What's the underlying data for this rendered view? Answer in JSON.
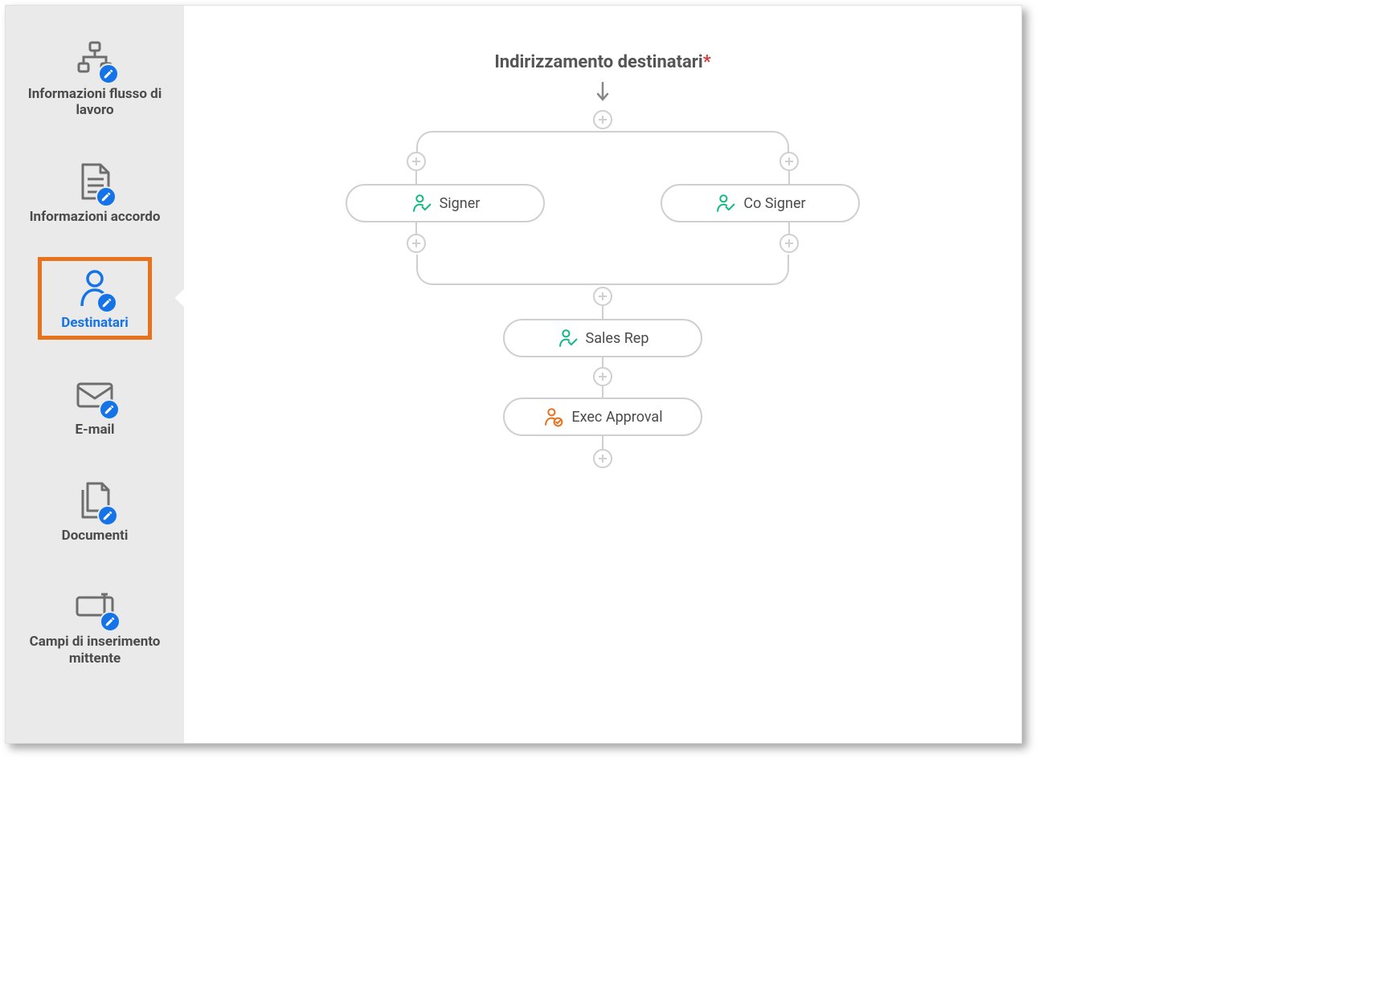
{
  "sidebar": {
    "items": [
      {
        "label": "Informazioni flusso di lavoro",
        "selected": false,
        "name": "sidebar-item-workflow-info",
        "icon": "workflow"
      },
      {
        "label": "Informazioni accordo",
        "selected": false,
        "name": "sidebar-item-agreement-info",
        "icon": "document-lines"
      },
      {
        "label": "Destinatari",
        "selected": true,
        "name": "sidebar-item-recipients",
        "icon": "person"
      },
      {
        "label": "E-mail",
        "selected": false,
        "name": "sidebar-item-emails",
        "icon": "envelope"
      },
      {
        "label": "Documenti",
        "selected": false,
        "name": "sidebar-item-documents",
        "icon": "documents"
      },
      {
        "label": "Campi di inserimento mittente",
        "selected": false,
        "name": "sidebar-item-sender-fields",
        "icon": "field"
      }
    ]
  },
  "canvas": {
    "title": "Indirizzamento destinatari",
    "required": "*"
  },
  "nodes": {
    "signer": {
      "label": "Signer",
      "role": "signer",
      "color": "#12b886"
    },
    "cosigner": {
      "label": "Co Signer",
      "role": "signer",
      "color": "#12b886"
    },
    "salesrep": {
      "label": "Sales Rep",
      "role": "signer",
      "color": "#12b886"
    },
    "exec": {
      "label": "Exec Approval",
      "role": "approver",
      "color": "#e8711c"
    }
  }
}
